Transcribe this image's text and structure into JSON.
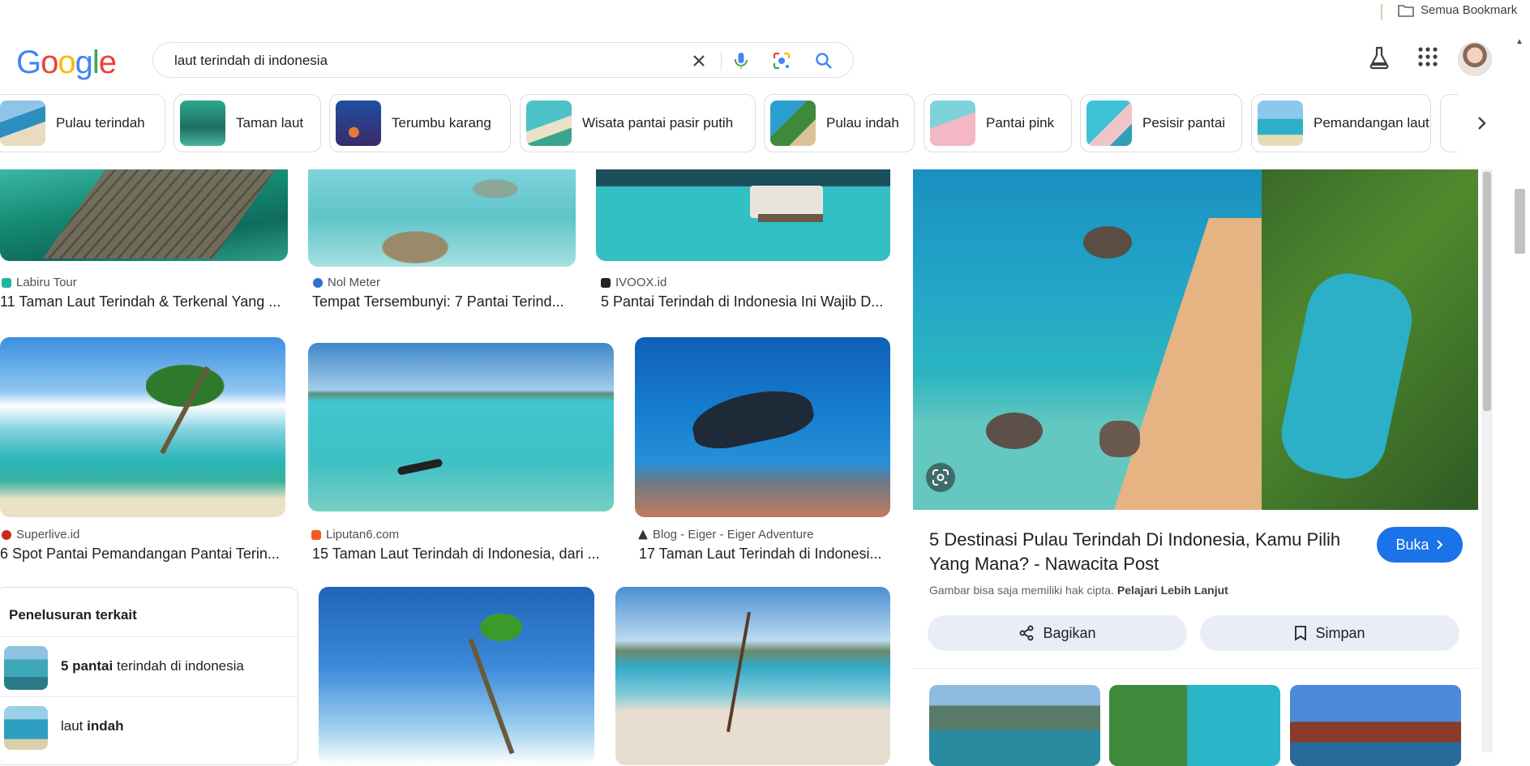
{
  "bookmarks": {
    "all_label": "Semua Bookmark",
    "icon": "folder-icon"
  },
  "logo": {
    "text": "Google"
  },
  "search": {
    "query": "laut terindah di indonesia",
    "icons": [
      "close-icon",
      "mic-icon",
      "lens-icon",
      "search-icon"
    ]
  },
  "header_icons": [
    "labs-icon",
    "apps-icon",
    "avatar"
  ],
  "chips": [
    {
      "label": "Pulau terindah"
    },
    {
      "label": "Taman laut"
    },
    {
      "label": "Terumbu karang"
    },
    {
      "label": "Wisata pantai pasir putih"
    },
    {
      "label": "Pulau indah"
    },
    {
      "label": "Pantai pink"
    },
    {
      "label": "Pesisir pantai"
    },
    {
      "label": "Pemandangan laut"
    }
  ],
  "results": [
    {
      "source": "Labiru Tour",
      "title": "11 Taman Laut Terindah & Terkenal Yang ..."
    },
    {
      "source": "Nol Meter",
      "title": "Tempat Tersembunyi: 7 Pantai Terind..."
    },
    {
      "source": "IVOOX.id",
      "title": "5 Pantai Terindah di Indonesia Ini Wajib D..."
    },
    {
      "source": "Superlive.id",
      "title": "6 Spot Pantai Pemandangan Pantai Terin..."
    },
    {
      "source": "Liputan6.com",
      "title": "15 Taman Laut Terindah di Indonesia, dari ..."
    },
    {
      "source": "Blog - Eiger - Eiger Adventure",
      "title": "17 Taman Laut Terindah di Indonesi..."
    }
  ],
  "related": {
    "title": "Penelusuran terkait",
    "items": [
      {
        "bold": "5 pantai",
        "rest": " terindah di indonesia"
      },
      {
        "plain": "laut ",
        "bold": "indah"
      }
    ]
  },
  "side_panel": {
    "title": "5 Destinasi Pulau Terindah Di Indonesia, Kamu Pilih Yang Mana? - Nawacita Post",
    "open_label": "Buka",
    "copyright_text": "Gambar bisa saja memiliki hak cipta.",
    "learn_more": "Pelajari Lebih Lanjut",
    "share_label": "Bagikan",
    "save_label": "Simpan"
  },
  "colors": {
    "accent": "#1a73e8",
    "chip_border": "#dadce0",
    "action_bg": "#e9eef6"
  }
}
